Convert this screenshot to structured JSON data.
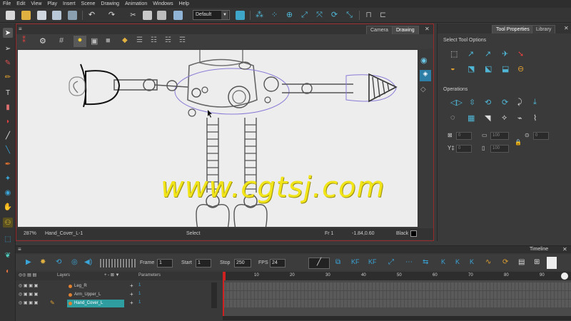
{
  "menu": [
    "File",
    "Edit",
    "View",
    "Play",
    "Insert",
    "Scene",
    "Drawing",
    "Animation",
    "Windows",
    "Help"
  ],
  "toolbar": {
    "workspace": "Default"
  },
  "view": {
    "tabs": [
      "Camera",
      "Drawing"
    ],
    "active_tab": "Drawing",
    "status": {
      "zoom": "287%",
      "layer": "Hand_Cover_L-1",
      "tool": "Select",
      "frame": "Fr 1",
      "coords": "-1.84,0.60",
      "color": "Black"
    },
    "watermark": "www.cgtsj.com"
  },
  "right_panel": {
    "tabs": [
      "Tool Properties",
      "Library"
    ],
    "active_tab": "Tool Properties",
    "tool_options_title": "Select Tool Options",
    "operations_title": "Operations",
    "fields": {
      "x_val": "0",
      "y_val": "0",
      "w_val": "100",
      "h_val": "100",
      "angle_val": "0"
    }
  },
  "timeline": {
    "title": "Timeline",
    "frame_label": "Frame",
    "frame_value": "1",
    "start_label": "Start",
    "start_value": "1",
    "stop_label": "Stop",
    "stop_value": "250",
    "fps_label": "FPS",
    "fps_value": "24",
    "layers_label": "Layers",
    "parameters_label": "Parameters",
    "layers": [
      {
        "name": "Leg_R",
        "value": "1"
      },
      {
        "name": "Arm_Upper_L",
        "value": "1"
      },
      {
        "name": "Hand_Cover_L",
        "value": "1",
        "selected": true
      }
    ],
    "ruler_ticks": [
      "10",
      "20",
      "30",
      "40",
      "50",
      "60",
      "70",
      "80",
      "90"
    ]
  },
  "colors": {
    "accent_red": "#c0302a",
    "selected_layer": "#2f9ea0",
    "watermark": "#f1e51a"
  }
}
